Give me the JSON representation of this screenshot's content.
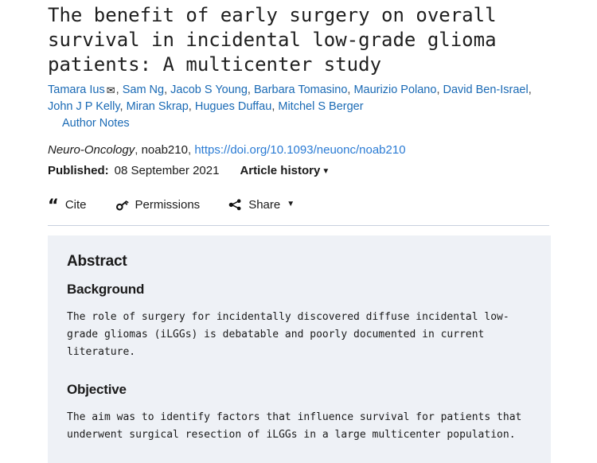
{
  "article": {
    "title": "The benefit of early surgery on overall survival in incidental low-grade glioma patients: A multicenter study",
    "authors": [
      {
        "name": "Tamara Ius",
        "has_corresponding_icon": true
      },
      {
        "name": "Sam Ng",
        "has_corresponding_icon": false
      },
      {
        "name": "Jacob S Young",
        "has_corresponding_icon": false
      },
      {
        "name": "Barbara Tomasino",
        "has_corresponding_icon": false
      },
      {
        "name": "Maurizio Polano",
        "has_corresponding_icon": false
      },
      {
        "name": "David Ben-Israel",
        "has_corresponding_icon": false
      },
      {
        "name": "John J P Kelly",
        "has_corresponding_icon": false
      },
      {
        "name": "Miran Skrap",
        "has_corresponding_icon": false
      },
      {
        "name": "Hugues Duffau",
        "has_corresponding_icon": false
      },
      {
        "name": "Mitchel S Berger",
        "has_corresponding_icon": false
      }
    ],
    "author_notes_label": "Author Notes",
    "corresponding_icon": "envelope-icon",
    "journal": "Neuro-Oncology",
    "article_id": "noab210",
    "doi_url": "https://doi.org/10.1093/neuonc/noab210",
    "published_label": "Published:",
    "published_date": "08 September 2021",
    "article_history_label": "Article history",
    "caret_glyph": "▼"
  },
  "toolbar": {
    "cite_label": "Cite",
    "cite_icon": "quote-icon",
    "permissions_label": "Permissions",
    "permissions_icon": "key-icon",
    "share_label": "Share",
    "share_icon": "share-nodes-icon",
    "share_caret": "▼"
  },
  "abstract": {
    "heading": "Abstract",
    "sections": [
      {
        "heading": "Background",
        "text": "The role of surgery for incidentally discovered diffuse incidental low-grade gliomas (iLGGs) is debatable and poorly documented in current literature."
      },
      {
        "heading": "Objective",
        "text": "The aim was to identify factors that influence survival for patients that underwent surgical resection of iLGGs in a large multicenter population."
      }
    ]
  },
  "colors": {
    "link_blue": "#1a6ab5",
    "doi_blue": "#2a7bd4",
    "abstract_bg": "#eef1f6",
    "divider": "#c8d0de",
    "text": "#1a1a1a"
  }
}
